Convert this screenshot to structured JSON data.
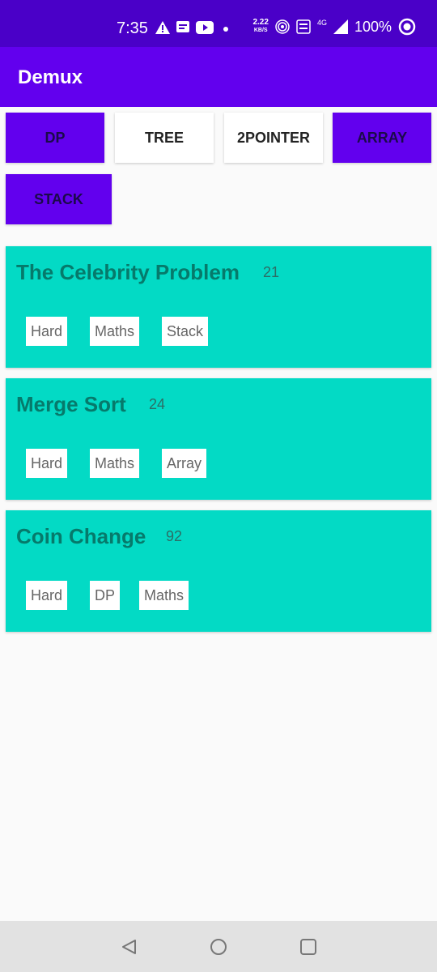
{
  "status_bar": {
    "time": "7:35",
    "speed": "2.22",
    "speed_unit": "KB/S",
    "network": "4G",
    "battery": "100%"
  },
  "app_bar": {
    "title": "Demux"
  },
  "filters": [
    {
      "label": "DP",
      "selected": true
    },
    {
      "label": "TREE",
      "selected": false
    },
    {
      "label": "2POINTER",
      "selected": false
    },
    {
      "label": "ARRAY",
      "selected": true
    },
    {
      "label": "STACK",
      "selected": true
    }
  ],
  "problems": [
    {
      "title": "The Celebrity Problem",
      "count": "21",
      "tags": [
        "Hard",
        "Maths",
        "Stack"
      ]
    },
    {
      "title": "Merge Sort",
      "count": "24",
      "tags": [
        "Hard",
        "Maths",
        "Array"
      ]
    },
    {
      "title": "Coin Change",
      "count": "92",
      "tags": [
        "Hard",
        "DP",
        "Maths"
      ]
    }
  ],
  "colors": {
    "primary": "#6200ee",
    "status_bar": "#4a00c8",
    "card": "#03dac5"
  }
}
